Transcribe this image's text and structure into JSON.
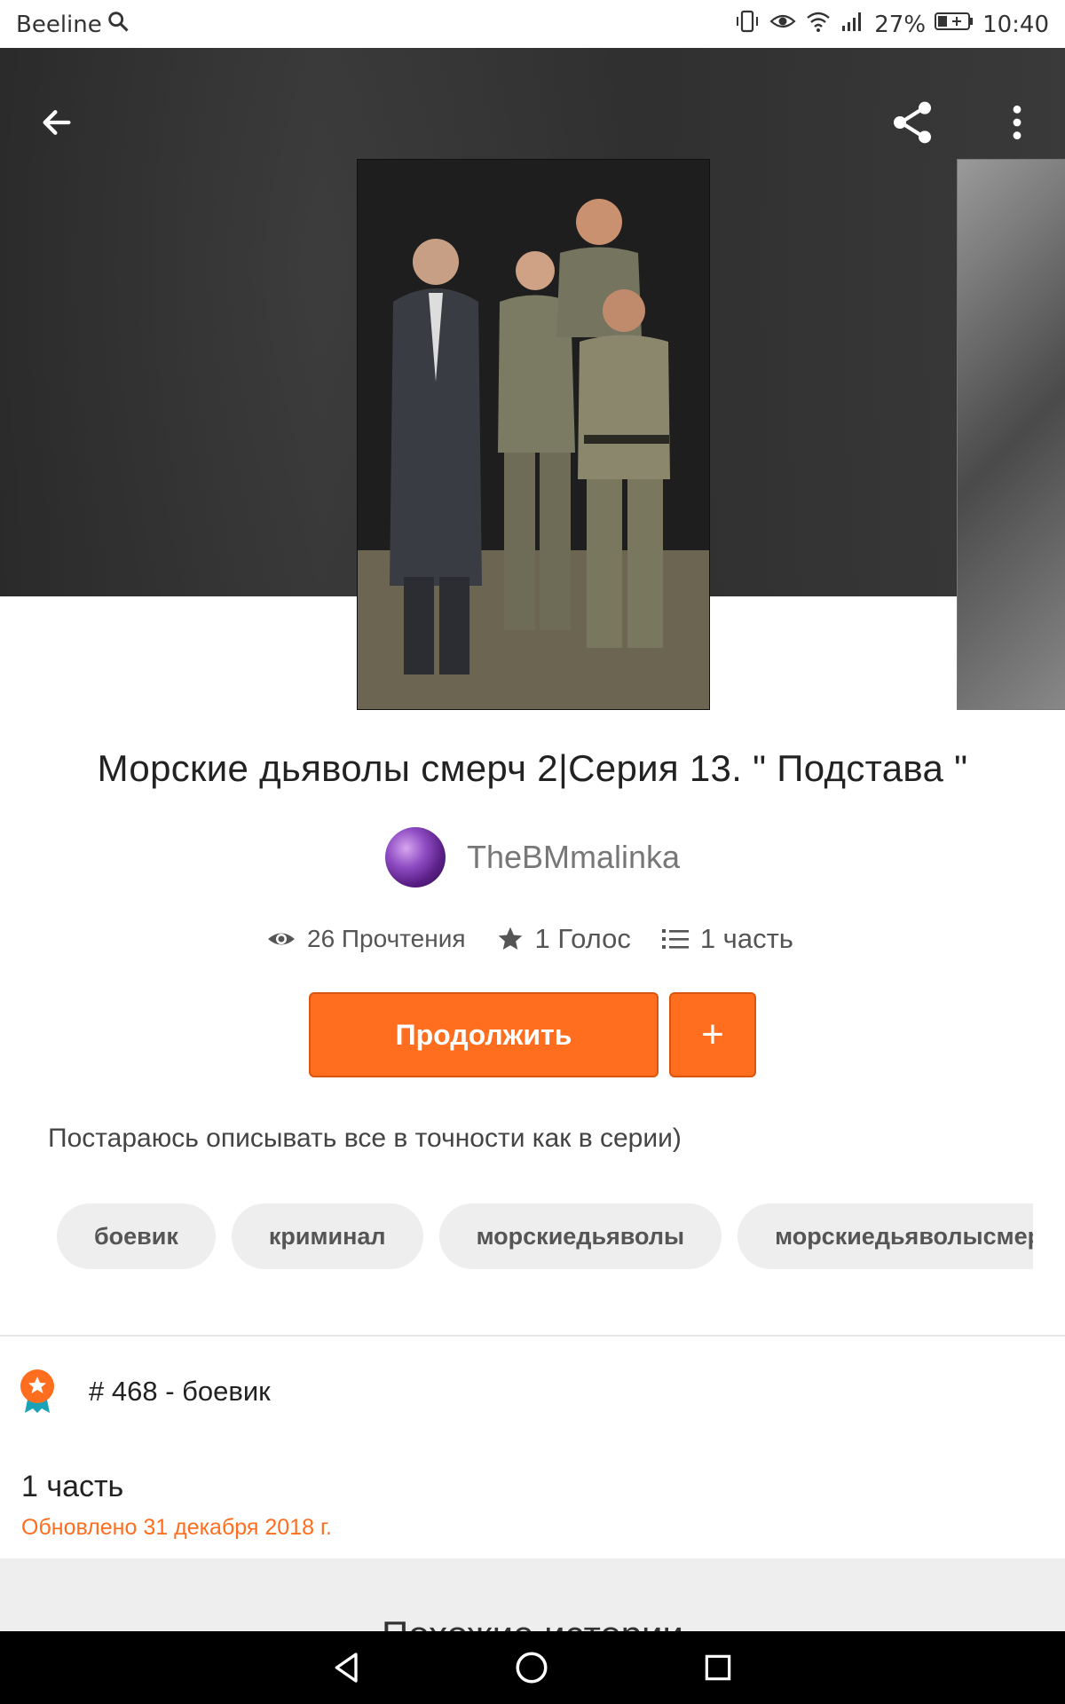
{
  "status_bar": {
    "carrier": "Beeline",
    "battery": "27%",
    "time": "10:40"
  },
  "story": {
    "title": "Морские дьяволы смерч 2|Серия 13. \" Подстава \"",
    "author": "TheBMmalinka",
    "reads": "26 Прочтения",
    "votes": "1 Голос",
    "parts": "1 часть",
    "continue_label": "Продолжить",
    "add_label": "+",
    "description": "Постараюсь описывать все в точности как в серии)",
    "tags": [
      "боевик",
      "криминал",
      "морскиедьяволы",
      "морскиедьяволысмерч"
    ],
    "rank": "# 468 - боевик",
    "parts_count": "1 часть",
    "updated": "Обновлено 31 декабря 2018 г."
  },
  "similar": {
    "title": "Похожие истории"
  },
  "colors": {
    "accent": "#ff6e1f",
    "tag_bg": "#eeeeee"
  }
}
